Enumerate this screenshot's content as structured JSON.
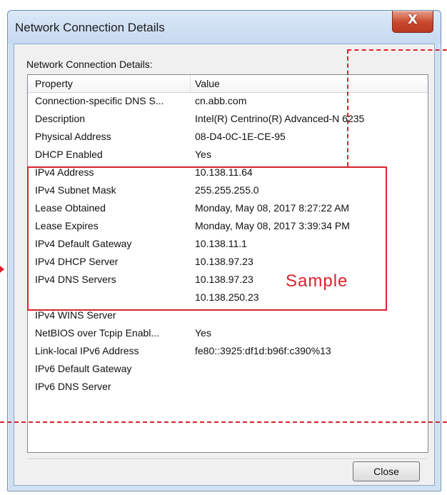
{
  "window": {
    "title": "Network Connection Details",
    "close_glyph": "X"
  },
  "group_label": "Network Connection Details:",
  "table": {
    "columns": [
      "Property",
      "Value"
    ],
    "rows": [
      {
        "property": "Connection-specific DNS S...",
        "value": "cn.abb.com"
      },
      {
        "property": "Description",
        "value": "Intel(R) Centrino(R) Advanced-N 6235"
      },
      {
        "property": "Physical Address",
        "value": "08-D4-0C-1E-CE-95"
      },
      {
        "property": "DHCP Enabled",
        "value": "Yes"
      },
      {
        "property": "IPv4 Address",
        "value": "10.138.11.64"
      },
      {
        "property": "IPv4 Subnet Mask",
        "value": "255.255.255.0"
      },
      {
        "property": "Lease Obtained",
        "value": "Monday, May 08, 2017 8:27:22 AM"
      },
      {
        "property": "Lease Expires",
        "value": "Monday, May 08, 2017 3:39:34 PM"
      },
      {
        "property": "IPv4 Default Gateway",
        "value": "10.138.11.1"
      },
      {
        "property": "IPv4 DHCP Server",
        "value": "10.138.97.23"
      },
      {
        "property": "IPv4 DNS Servers",
        "value": "10.138.97.23"
      },
      {
        "property": "",
        "value": "10.138.250.23"
      },
      {
        "property": "IPv4 WINS Server",
        "value": ""
      },
      {
        "property": "NetBIOS over Tcpip Enabl...",
        "value": "Yes"
      },
      {
        "property": "Link-local IPv6 Address",
        "value": "fe80::3925:df1d:b96f:c390%13"
      },
      {
        "property": "IPv6 Default Gateway",
        "value": ""
      },
      {
        "property": "IPv6 DNS Server",
        "value": ""
      }
    ]
  },
  "buttons": {
    "close_label": "Close"
  },
  "annotation": {
    "sample_label": "Sample",
    "color": "#d9232d"
  }
}
